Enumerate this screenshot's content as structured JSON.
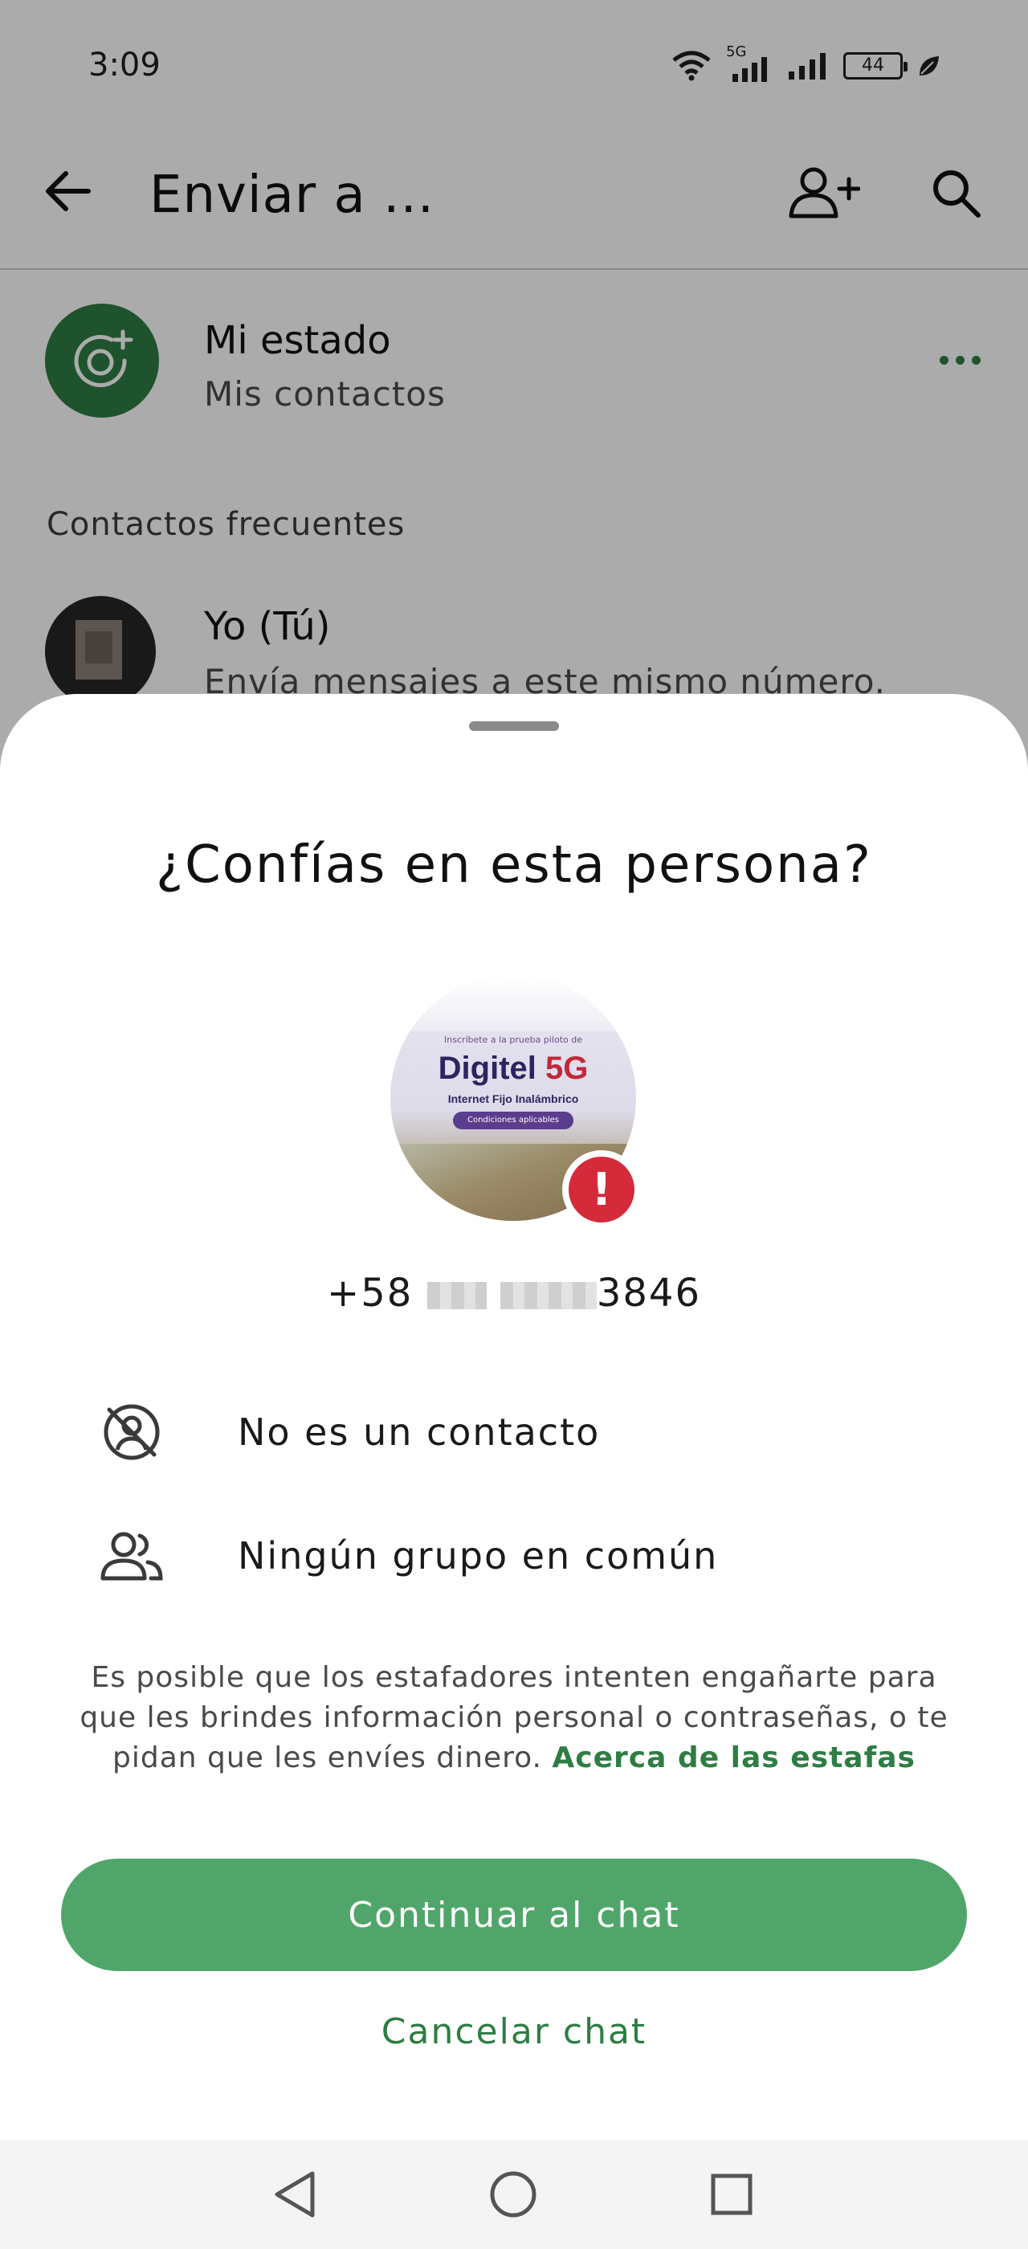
{
  "status_bar": {
    "time": "3:09",
    "network": "5G",
    "battery": "44"
  },
  "header": {
    "title": "Enviar a ...",
    "icons": [
      "back-arrow-icon",
      "add-contact-icon",
      "search-icon"
    ]
  },
  "my_status": {
    "name": "Mi estado",
    "subtitle": "Mis contactos"
  },
  "frequent": {
    "label": "Contactos frecuentes",
    "contacts": [
      {
        "name": "Yo (Tú)",
        "subtitle": "Envía mensajes a este mismo número."
      }
    ]
  },
  "dialog": {
    "title": "¿Confías en esta persona?",
    "profile_image": {
      "tagline": "Inscríbete a la prueba piloto de",
      "brand": "Digitel",
      "brand_suffix": "5G",
      "service": "Internet Fijo Inalámbrico",
      "pill": "Condiciones aplicables"
    },
    "phone": {
      "prefix": "+58",
      "suffix": "3846"
    },
    "info": [
      {
        "icon": "no-contact-icon",
        "label": "No es un contacto"
      },
      {
        "icon": "group-icon",
        "label": "Ningún grupo en común"
      }
    ],
    "warning_text": "Es posible que los estafadores intenten engañarte para que les brindes información personal o contraseñas, o te pidan que les envíes dinero.",
    "warning_link": "Acerca de las estafas",
    "continue_label": "Continuar al chat",
    "cancel_label": "Cancelar chat"
  },
  "colors": {
    "accent": "#2e7d43",
    "button": "#50a66a",
    "warning": "#d42a3a"
  }
}
